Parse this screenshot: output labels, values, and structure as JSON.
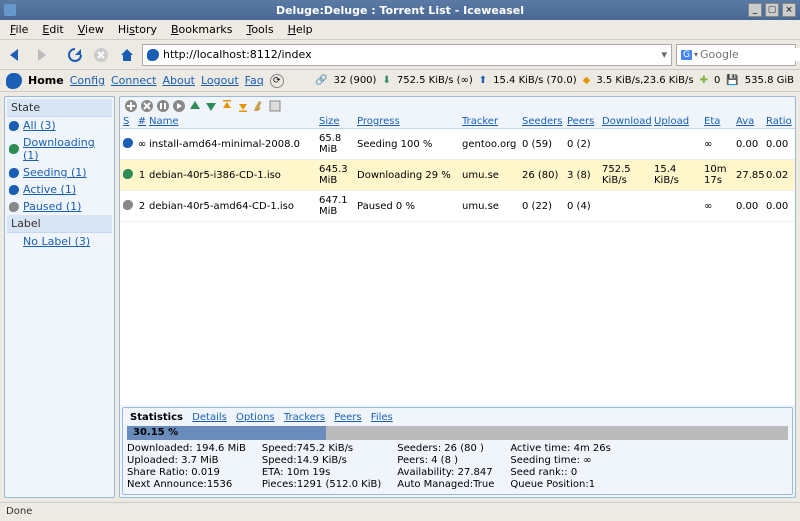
{
  "window": {
    "title": "Deluge:Deluge : Torrent List - Iceweasel"
  },
  "menubar": {
    "file": "File",
    "edit": "Edit",
    "view": "View",
    "history": "History",
    "bookmarks": "Bookmarks",
    "tools": "Tools",
    "help": "Help"
  },
  "toolbar": {
    "url": "http://localhost:8112/index",
    "search_placeholder": "Google"
  },
  "appbar": {
    "home": "Home",
    "config": "Config",
    "connect": "Connect",
    "about": "About",
    "logout": "Logout",
    "faq": "Faq",
    "stats": {
      "connections": "32 (900)",
      "down": "752.5 KiB/s (∞)",
      "up": "15.4 KiB/s (70.0)",
      "dht": "3.5 KiB/s,23.6 KiB/s",
      "free_pre": "0",
      "free": "535.8 GiB"
    }
  },
  "sidebar": {
    "state_label": "State",
    "items": [
      {
        "label": "All (3)",
        "color": "#1a5fb4"
      },
      {
        "label": "Downloading (1)",
        "color": "#2e8b57"
      },
      {
        "label": "Seeding (1)",
        "color": "#1a5fb4"
      },
      {
        "label": "Active (1)",
        "color": "#1a5fb4"
      },
      {
        "label": "Paused (1)",
        "color": "#888"
      }
    ],
    "label_label": "Label",
    "label_items": [
      {
        "label": "No Label (3)"
      }
    ]
  },
  "columns": {
    "s": "S",
    "n": "#",
    "name": "Name",
    "size": "Size",
    "progress": "Progress",
    "tracker": "Tracker",
    "seeders": "Seeders",
    "peers": "Peers",
    "download": "Download",
    "upload": "Upload",
    "eta": "Eta",
    "ava": "Ava",
    "ratio": "Ratio"
  },
  "torrents": [
    {
      "n": "∞",
      "name": "install-amd64-minimal-2008.0",
      "size": "65.8 MiB",
      "progress": "Seeding 100 %",
      "tracker": "gentoo.org",
      "seeders": "0 (59)",
      "peers": "0 (2)",
      "dl": "",
      "ul": "",
      "eta": "∞",
      "ava": "0.00",
      "ratio": "0.00",
      "color": "#1a5fb4",
      "sel": false
    },
    {
      "n": "1",
      "name": "debian-40r5-i386-CD-1.iso",
      "size": "645.3 MiB",
      "progress": "Downloading 29 %",
      "tracker": "umu.se",
      "seeders": "26 (80)",
      "peers": "3 (8)",
      "dl": "752.5 KiB/s",
      "ul": "15.4 KiB/s",
      "eta": "10m 17s",
      "ava": "27.85",
      "ratio": "0.02",
      "color": "#2e8b57",
      "sel": true
    },
    {
      "n": "2",
      "name": "debian-40r5-amd64-CD-1.iso",
      "size": "647.1 MiB",
      "progress": "Paused 0 %",
      "tracker": "umu.se",
      "seeders": "0 (22)",
      "peers": "0 (4)",
      "dl": "",
      "ul": "",
      "eta": "∞",
      "ava": "0.00",
      "ratio": "0.00",
      "color": "#888",
      "sel": false
    }
  ],
  "detail": {
    "tabs": {
      "statistics": "Statistics",
      "details": "Details",
      "options": "Options",
      "trackers": "Trackers",
      "peers": "Peers",
      "files": "Files"
    },
    "pct": "30.15 %",
    "pct_w": 30.15,
    "col1": {
      "downloaded_l": "Downloaded:",
      "downloaded": "194.6 MiB",
      "uploaded_l": "Uploaded:",
      "uploaded": "3.7 MiB",
      "ratio_l": "Share Ratio:",
      "ratio": "0.019",
      "next_l": "Next Announce:",
      "next": "1536"
    },
    "col2": {
      "speed_d_l": "Speed:",
      "speed_d": "745.2 KiB/s",
      "speed_u_l": "Speed:",
      "speed_u": "14.9 KiB/s",
      "eta_l": "ETA:",
      "eta": "10m 19s",
      "pieces_l": "Pieces:",
      "pieces": "1291 (512.0 KiB)"
    },
    "col3": {
      "seeders_l": "Seeders:",
      "seeders": "26 (80 )",
      "peers_l": "Peers:",
      "peers": "4 (8 )",
      "avail_l": "Availability:",
      "avail": "27.847",
      "auto_l": "Auto Managed:",
      "auto": "True"
    },
    "col4": {
      "active_l": "Active time:",
      "active": "4m 26s",
      "seeding_l": "Seeding time:",
      "seeding": "∞",
      "rank_l": "Seed rank::",
      "rank": "0",
      "queue_l": "Queue Position:",
      "queue": "1"
    }
  },
  "statusbar": {
    "text": "Done"
  }
}
